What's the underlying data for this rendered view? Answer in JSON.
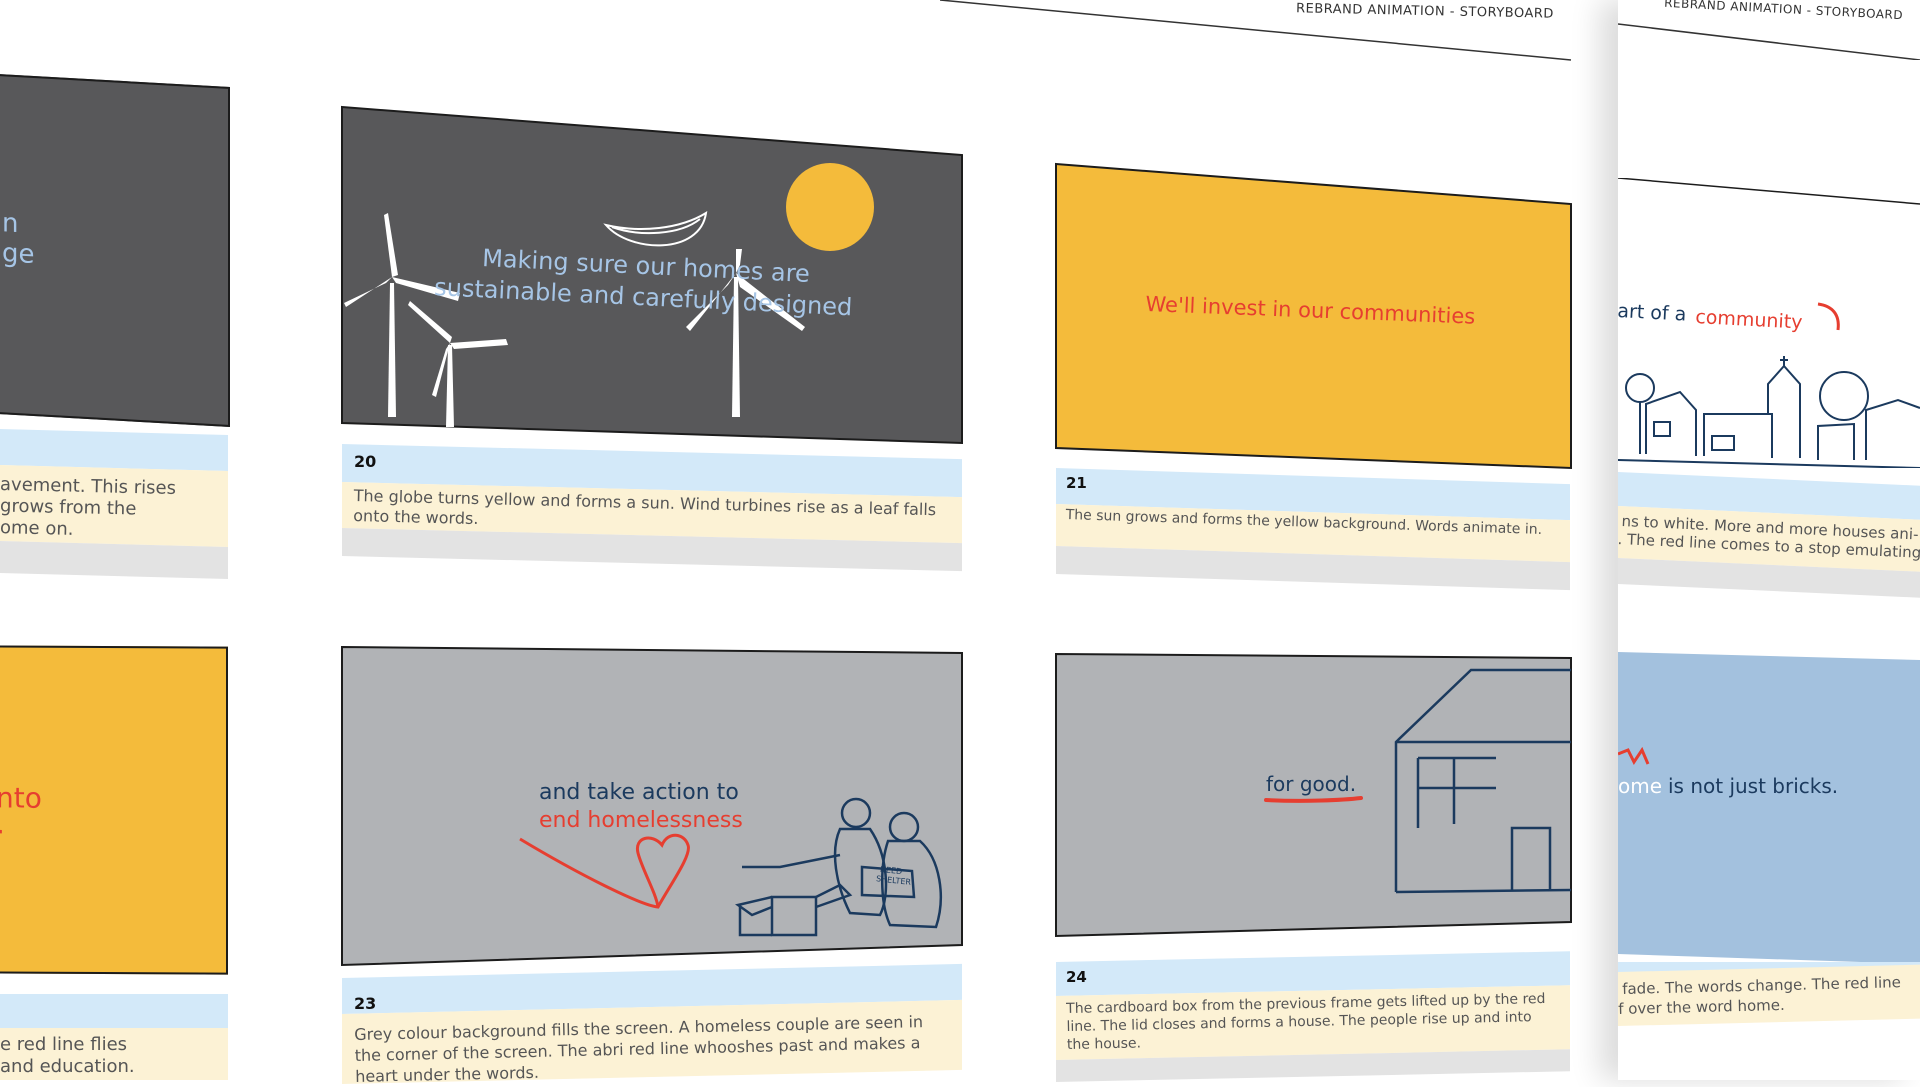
{
  "header": {
    "title_main": "REBRAND ANIMATION - STORYBOARD",
    "title_second": "REBRAND ANIMATION - STORYBOARD"
  },
  "colors": {
    "dark_grey": "#58585a",
    "yellow": "#f4bb3b",
    "light_grey": "#b1b3b6",
    "light_blue": "#a3c1de",
    "red": "#e63e30",
    "navy": "#1b3a5e",
    "pale_blue_text": "#a6c5e6"
  },
  "left_column": {
    "top": {
      "frame_text_line1": "n",
      "frame_text_line2": "ge",
      "desc_line1": "avement. This rises",
      "desc_line2": "grows from the",
      "desc_line3": "ome on."
    },
    "bottom": {
      "frame_text_line1": "nto",
      "frame_text_line2": ".",
      "desc_line1": "e red line flies",
      "desc_line2": "and education."
    }
  },
  "frames": {
    "f20": {
      "number": "20",
      "frame_text_line1": "Making sure our homes are",
      "frame_text_line2": "sustainable and carefully designed",
      "description": "The globe turns yellow and forms a sun. Wind turbines rise as a leaf falls onto the words."
    },
    "f21": {
      "number": "21",
      "frame_text": "We'll invest in our communities",
      "description": "The sun grows and forms the yellow background. Words animate in."
    },
    "f23": {
      "number": "23",
      "frame_text_line1": "and take action to",
      "frame_text_line2": "end homelessness",
      "sign_line1": "NEED",
      "sign_line2": "SHELTER",
      "description": "Grey colour background fills the screen. A homeless couple are seen in the corner of the screen. The abri red line whooshes past and makes a heart under the words."
    },
    "f24": {
      "number": "24",
      "frame_text": "for good.",
      "description": "The cardboard box from the previous frame gets lifted up by the red line. The lid closes and forms a house. The people rise up and into the house."
    }
  },
  "right_page": {
    "top": {
      "frame_text_prefix": "art of a ",
      "frame_text_highlight": "community",
      "desc_line1": "ns to white. More and more houses ani-",
      "desc_line2": ". The red line comes to a stop emulating"
    },
    "bottom": {
      "frame_text_prefix": "ome",
      "frame_text_rest": " is not just bricks.",
      "desc_line1": "fade. The words change. The red line",
      "desc_line2": "f over the word home."
    }
  }
}
